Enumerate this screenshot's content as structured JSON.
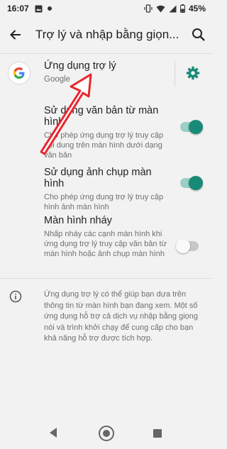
{
  "status_bar": {
    "time": "16:07",
    "battery": "45%"
  },
  "app_bar": {
    "title": "Trợ lý và nhập bằng giọn..."
  },
  "assistant_app": {
    "title": "Ứng dụng trợ lý",
    "value": "Google"
  },
  "settings": [
    {
      "title": "Sử dụng văn bản từ màn hình",
      "subtitle": "Cho phép ứng dụng trợ lý truy cập nội dung trên màn hình dưới dạng văn bản",
      "enabled": true
    },
    {
      "title": "Sử dụng ảnh chụp màn hình",
      "subtitle": "Cho phép ứng dụng trợ lý truy cập hình ảnh màn hình",
      "enabled": true
    },
    {
      "title": "Màn hình nháy",
      "subtitle": "Nhấp nháy các cạnh màn hình khi ứng dụng trợ lý truy cập văn bản từ màn hình hoặc ảnh chụp màn hình",
      "enabled": false
    }
  ],
  "footer": {
    "text": "Ứng dụng trợ lý có thể giúp bạn dựa trên thông tin từ màn hình bạn đang xem. Một số ứng dụng hỗ trợ cả dịch vụ nhập bằng giọng nói và trình khởi chạy để cung cấp cho bạn khả năng hỗ trợ được tích hợp."
  },
  "colors": {
    "accent": "#1a8a78",
    "annotation_arrow": "#e8262e"
  }
}
